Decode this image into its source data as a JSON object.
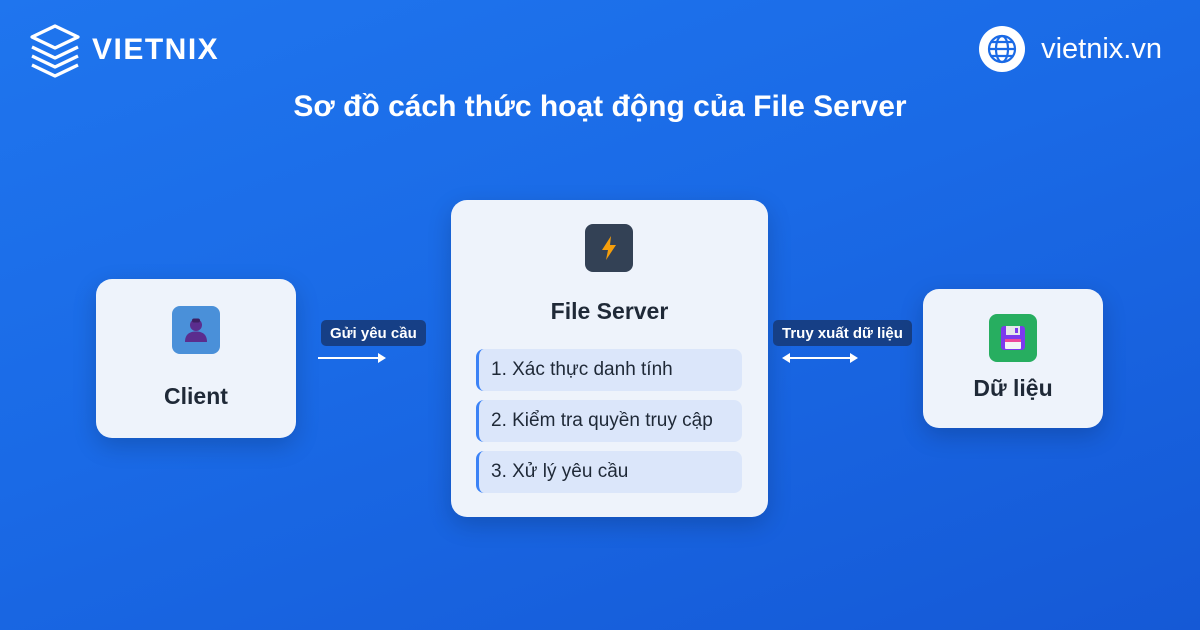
{
  "brand": {
    "logo_text": "VIETNIX",
    "site_text": "vietnix.vn"
  },
  "title": "Sơ đồ cách thức hoạt động của File Server",
  "client": {
    "label": "Client",
    "icon": "user-icon"
  },
  "server": {
    "label": "File Server",
    "icon": "lightning-icon",
    "steps": [
      "1. Xác thực danh tính",
      "2. Kiểm tra quyền truy cập",
      "3. Xử lý yêu cầu"
    ]
  },
  "data_store": {
    "label": "Dữ liệu",
    "icon": "floppy-disk-icon"
  },
  "links": {
    "client_to_server": "Gửi yêu cầu",
    "server_to_data": "Truy xuất dữ liệu"
  },
  "colors": {
    "background": "#1a6ae6",
    "card": "#eef3fb",
    "step": "#dbe6fa",
    "badge": "#163f86",
    "client_icon_bg": "#4a90d9",
    "server_icon_bg": "#334155",
    "data_icon_bg": "#27ae60"
  }
}
